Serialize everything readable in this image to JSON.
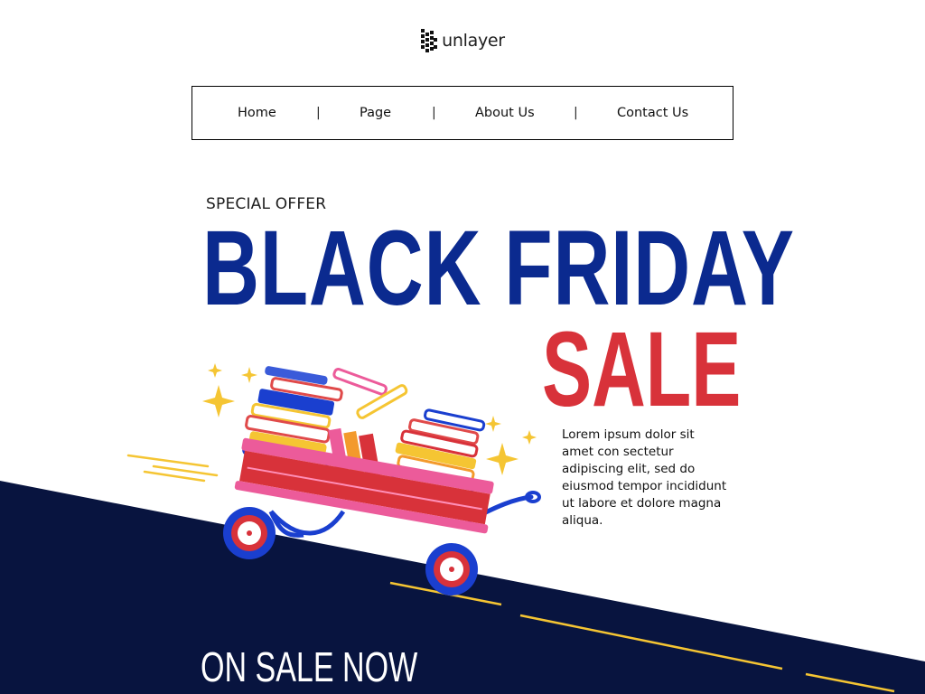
{
  "logo": {
    "text": "unlayer",
    "icon": "unlayer-logo-icon"
  },
  "nav": {
    "items": [
      {
        "label": "Home"
      },
      {
        "label": "Page"
      },
      {
        "label": "About Us"
      },
      {
        "label": "Contact Us"
      }
    ],
    "separator": "|"
  },
  "hero": {
    "eyebrow": "SPECIAL OFFER",
    "headline": "BLACK FRIDAY",
    "headline_accent": "SALE",
    "body": "Lorem ipsum dolor sit amet con sectetur adipiscing elit, sed do eiusmod tempor incididunt ut labore et dolore magna aliqua.",
    "cta_heading": "ON SALE NOW"
  },
  "illustration": {
    "icon": "wagon-with-books-icon"
  },
  "colors": {
    "navy": "#08143f",
    "headline_blue": "#0b2a8f",
    "sale_red": "#d8323a",
    "accent_yellow": "#f5c533"
  }
}
